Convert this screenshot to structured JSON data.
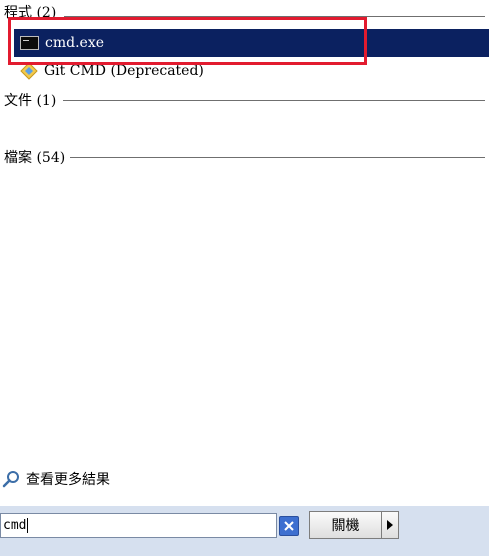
{
  "sections": {
    "programs": {
      "label": "程式 (2)"
    },
    "documents": {
      "label": "文件 (1)"
    },
    "files": {
      "label": "檔案 (54)"
    }
  },
  "results": [
    {
      "label": "cmd.exe",
      "icon": "cmd-icon",
      "selected": true
    },
    {
      "label": "Git CMD (Deprecated)",
      "icon": "git-icon",
      "selected": false
    }
  ],
  "see_more": {
    "label": "查看更多結果",
    "icon": "magnifier-icon"
  },
  "search": {
    "value": "cmd"
  },
  "shutdown": {
    "label": "關機"
  },
  "colors": {
    "selection": "#0b2160",
    "highlight_box": "#e21b2f",
    "bottom_bar": "#d6e0ef"
  }
}
